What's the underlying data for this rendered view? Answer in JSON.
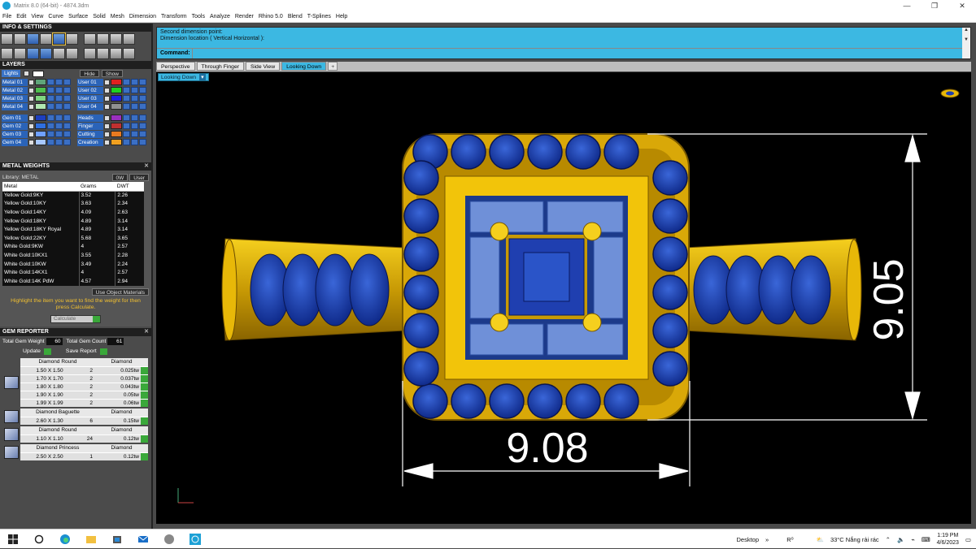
{
  "window": {
    "title": "Matrix 8.0 (64-bit) - 4874.3dm",
    "controls": [
      "—",
      "❐",
      "✕"
    ]
  },
  "menu": [
    "File",
    "Edit",
    "View",
    "Curve",
    "Surface",
    "Solid",
    "Mesh",
    "Dimension",
    "Transform",
    "Tools",
    "Analyze",
    "Render",
    "Rhino 5.0",
    "Blend",
    "T-Splines",
    "Help"
  ],
  "info_panel": {
    "title": "INFO & SETTINGS"
  },
  "layers": {
    "title": "LAYERS",
    "lights_label": "Lights",
    "hide_label": "Hide",
    "show_label": "Show",
    "left": [
      {
        "name": "Metal 01",
        "color": "#5fa57a"
      },
      {
        "name": "Metal 02",
        "color": "#4fbf4f"
      },
      {
        "name": "Metal 03",
        "color": "#7fd67f"
      },
      {
        "name": "Metal 04",
        "color": "#b0e8b0"
      },
      {
        "name": "Gem 01",
        "color": "#1d3fbf"
      },
      {
        "name": "Gem 02",
        "color": "#2f6fe0"
      },
      {
        "name": "Gem 03",
        "color": "#6fa0ff"
      },
      {
        "name": "Gem 04",
        "color": "#a8c8ff"
      }
    ],
    "right": [
      {
        "name": "User 01",
        "color": "#e02020"
      },
      {
        "name": "User 02",
        "color": "#20d020"
      },
      {
        "name": "User 03",
        "color": "#2020e0"
      },
      {
        "name": "User 04",
        "color": "#909090"
      },
      {
        "name": "Heads",
        "color": "#9a2fbf"
      },
      {
        "name": "Finger",
        "color": "#c03030"
      },
      {
        "name": "Cutting",
        "color": "#e87a20"
      },
      {
        "name": "Creation",
        "color": "#f0a020"
      }
    ]
  },
  "metal_weights": {
    "title": "METAL WEIGHTS",
    "library_label": "Library: METAL",
    "lib_btn1": "0W",
    "lib_btn2": "User",
    "columns": [
      "Metal",
      "Grams",
      "DWT"
    ],
    "rows": [
      [
        "Yellow Gold:9KY",
        "3.52",
        "2.26"
      ],
      [
        "Yellow Gold:10KY",
        "3.63",
        "2.34"
      ],
      [
        "Yellow Gold:14KY",
        "4.09",
        "2.63"
      ],
      [
        "Yellow Gold:18KY",
        "4.89",
        "3.14"
      ],
      [
        "Yellow Gold:18KY Royal",
        "4.89",
        "3.14"
      ],
      [
        "Yellow Gold:22KY",
        "5.68",
        "3.65"
      ],
      [
        "White Gold:9KW",
        "4",
        "2.57"
      ],
      [
        "White Gold:10KX1",
        "3.55",
        "2.28"
      ],
      [
        "White Gold:10KW",
        "3.49",
        "2.24"
      ],
      [
        "White Gold:14KX1",
        "4",
        "2.57"
      ],
      [
        "White Gold:14K PdW",
        "4.57",
        "2.94"
      ]
    ],
    "use_object_materials": "Use Object Materials",
    "hint": "Highlight the item you want to find the weight for then press Calculate.",
    "calculate_label": "Calculate"
  },
  "gem_reporter": {
    "title": "GEM REPORTER",
    "total_weight_label": "Total Gem Weight",
    "total_weight": "60",
    "total_count_label": "Total Gem Count",
    "total_count": "61",
    "update_label": "Update",
    "save_label": "Save Report",
    "groups": [
      {
        "shape": "Diamond Round",
        "material": "Diamond",
        "rows": [
          [
            "1.50 X 1.50",
            "2",
            "0.025tw"
          ],
          [
            "1.70 X 1.70",
            "2",
            "0.037tw"
          ],
          [
            "1.80 X 1.80",
            "2",
            "0.043tw"
          ],
          [
            "1.90 X 1.90",
            "2",
            "0.05tw"
          ],
          [
            "1.99 X 1.99",
            "2",
            "0.06tw"
          ]
        ]
      },
      {
        "shape": "Diamond Baguette",
        "material": "Diamond",
        "rows": [
          [
            "2.60 X 1.30",
            "6",
            "0.15tw"
          ]
        ]
      },
      {
        "shape": "Diamond Round",
        "material": "Diamond",
        "rows": [
          [
            "1.10 X 1.10",
            "24",
            "0.12tw"
          ]
        ]
      },
      {
        "shape": "Diamond Princess",
        "material": "Diamond",
        "rows": [
          [
            "2.50 X 2.50",
            "1",
            "0.12tw"
          ]
        ]
      }
    ]
  },
  "command": {
    "history": [
      "Second dimension point:",
      "Dimension location ( Vertical  Horizontal ):"
    ],
    "prompt": "Command:"
  },
  "tabs": [
    "Perspective",
    "Through Finger",
    "Side View",
    "Looking Down",
    "+"
  ],
  "viewport": {
    "label": "Looking Down",
    "dim_width": "9.08",
    "dim_height": "9.05",
    "colors": {
      "gold": "#f2c40a",
      "gold_dark": "#b88a00",
      "sapphire": "#1a3ea8",
      "baguette": "#6f90d8"
    }
  },
  "taskbar": {
    "desktop_label": "Desktop",
    "weather": "33°C  Nắng rải rác",
    "time": "1:19 PM",
    "date": "4/6/2023"
  }
}
